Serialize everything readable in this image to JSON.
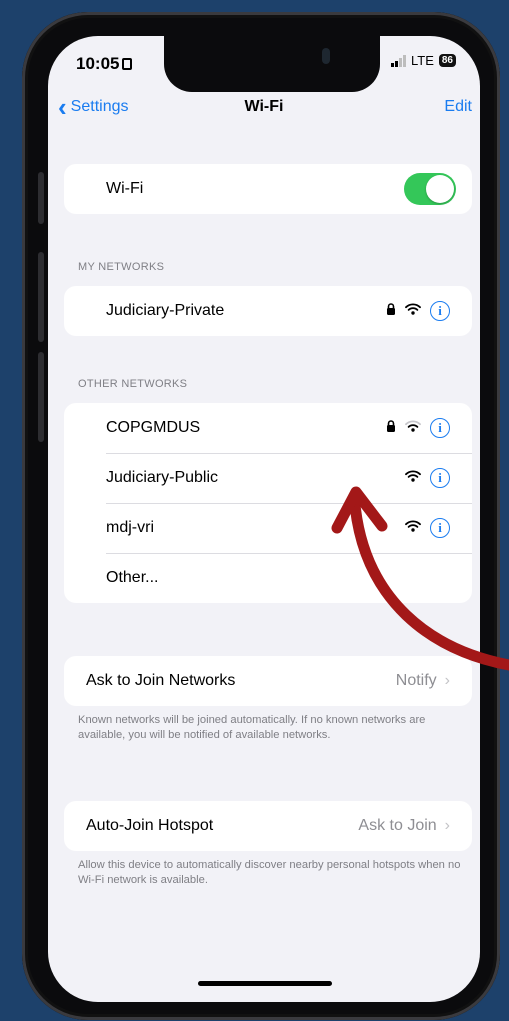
{
  "status": {
    "time": "10:05",
    "network": "LTE",
    "battery": "86"
  },
  "nav": {
    "back_label": "Settings",
    "title": "Wi-Fi",
    "edit_label": "Edit"
  },
  "wifi": {
    "label": "Wi-Fi",
    "enabled": true
  },
  "my_networks": {
    "header": "MY NETWORKS",
    "items": [
      {
        "name": "Judiciary-Private",
        "secured": true
      }
    ]
  },
  "other_networks": {
    "header": "OTHER NETWORKS",
    "items": [
      {
        "name": "COPGMDUS",
        "secured": true
      },
      {
        "name": "Judiciary-Public",
        "secured": false
      },
      {
        "name": "mdj-vri",
        "secured": false
      },
      {
        "name": "Other..."
      }
    ]
  },
  "ask_to_join": {
    "label": "Ask to Join Networks",
    "value": "Notify",
    "description": "Known networks will be joined automatically. If no known networks are available, you will be notified of available networks."
  },
  "auto_join": {
    "label": "Auto-Join Hotspot",
    "value": "Ask to Join",
    "description": "Allow this device to automatically discover nearby personal hotspots when no Wi-Fi network is available."
  },
  "colors": {
    "accent": "#1a7cf0",
    "toggle_on": "#34c759",
    "annotation_arrow": "#a31818",
    "background": "#1d416b"
  },
  "icons": {
    "lock": "lock-icon",
    "wifi": "wifi-signal-icon",
    "info": "info-icon"
  }
}
